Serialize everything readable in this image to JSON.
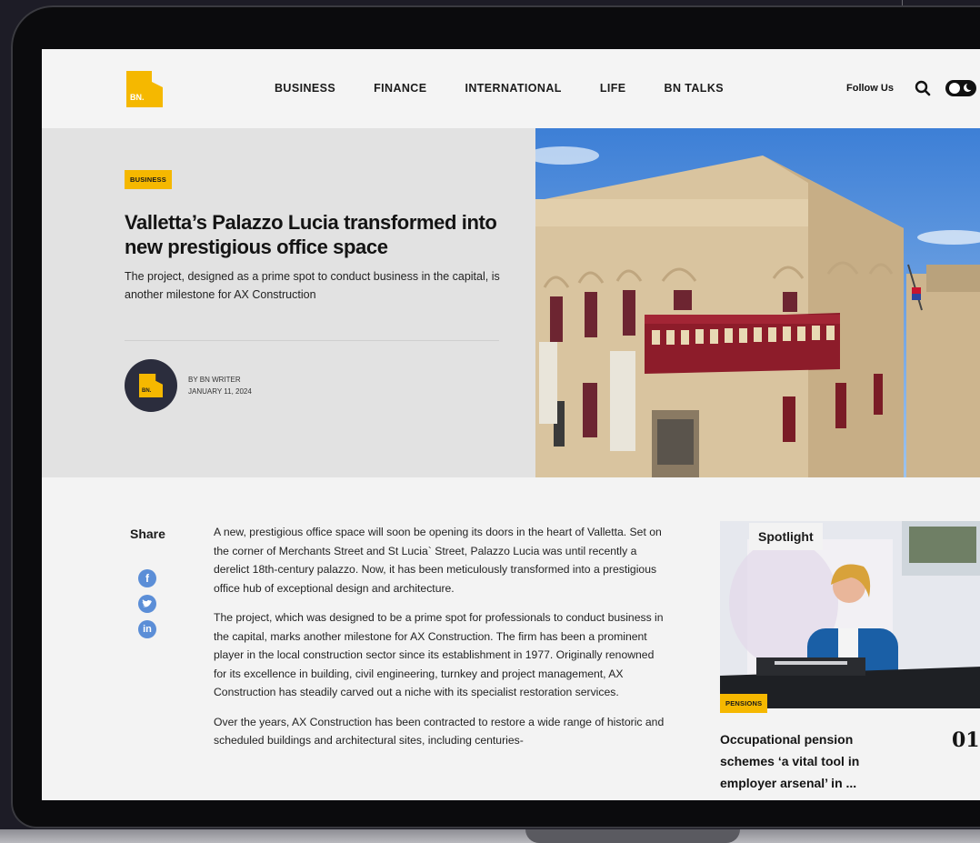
{
  "header": {
    "logo_text": "BN.",
    "nav": [
      "BUSINESS",
      "FINANCE",
      "INTERNATIONAL",
      "LIFE",
      "BN TALKS"
    ],
    "follow_label": "Follow Us",
    "icons": [
      "search-icon",
      "theme-toggle-icon"
    ]
  },
  "hero": {
    "tag": "BUSINESS",
    "title": "Valletta’s Palazzo Lucia transformed into new prestigious office space",
    "subtitle": "The project, designed as a prime spot to conduct business in the capital, is another milestone for AX Construction",
    "author_logo": "BN.",
    "byline": "BY BN WRITER",
    "date": "JANUARY 11, 2024"
  },
  "share": {
    "label": "Share",
    "icons": [
      "facebook-icon",
      "twitter-icon",
      "linkedin-icon"
    ]
  },
  "article": {
    "paragraphs": [
      "A new, prestigious office space will soon be opening its doors in the heart of Valletta. Set on the corner of Merchants Street and St Lucia` Street, Palazzo Lucia was until recently a derelict 18th-century palazzo. Now, it has been meticulously transformed into a prestigious office hub of exceptional design and architecture.",
      "The project, which was designed to be a prime spot for professionals to conduct business in the capital, marks another milestone for AX Construction. The firm has been a prominent player in the local construction sector since its establishment in 1977. Originally renowned for its excellence in building, civil engineering, turnkey and project management, AX Construction has steadily carved out a niche with its specialist restoration services.",
      "Over the years, AX Construction has been contracted to restore a wide range of historic and scheduled buildings and architectural sites, including centuries-"
    ]
  },
  "spotlight": {
    "label": "Spotlight",
    "tag": "PENSIONS",
    "title": "Occupational pension schemes ‘a vital tool in employer arsenal’ in ...",
    "number": "01"
  },
  "colors": {
    "accent": "#f5b800",
    "page_bg": "#f3f3f3",
    "hero_bg": "#e2e2e2",
    "dark": "#141414"
  }
}
